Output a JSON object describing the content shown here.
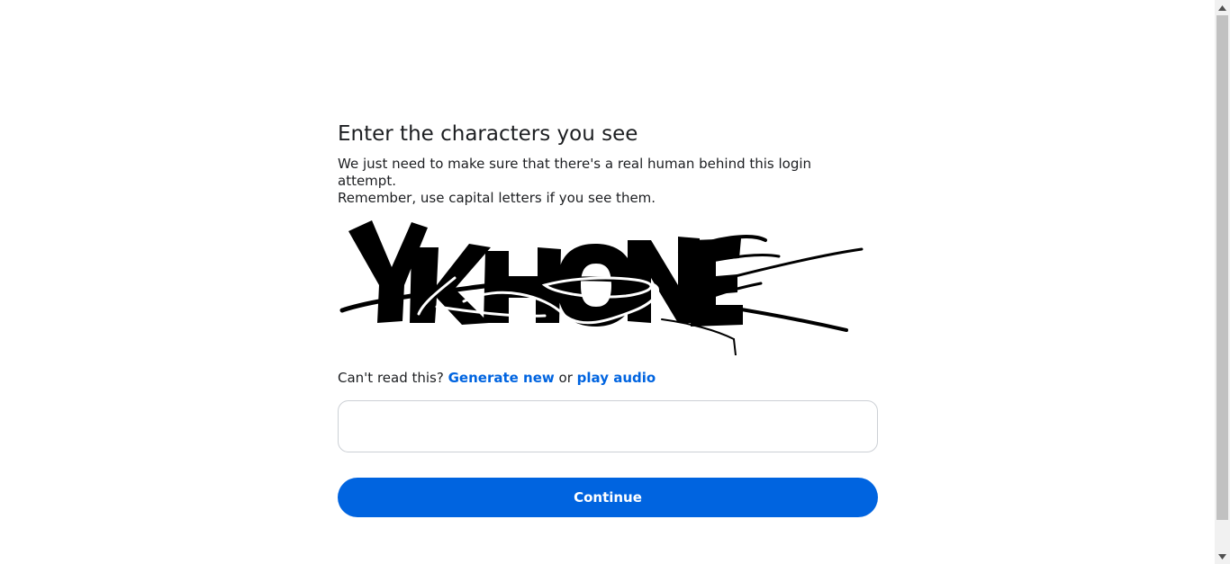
{
  "captcha_form": {
    "title": "Enter the characters you see",
    "description_line1": "We just need to make sure that there's a real human behind this login attempt.",
    "description_line2": "Remember, use capital letters if you see them.",
    "captcha_text": "YKHONE",
    "cant_read_prefix": "Can't read this?",
    "generate_new_label": "Generate new",
    "or_text": "or",
    "play_audio_label": "play audio",
    "input_value": "",
    "input_placeholder": "",
    "continue_label": "Continue"
  },
  "colors": {
    "accent": "#0064e0",
    "text": "#1c1e21",
    "input_border": "#ccd0d5"
  },
  "icons": {
    "scroll_up": "chevron-up-icon",
    "scroll_down": "chevron-down-icon"
  }
}
